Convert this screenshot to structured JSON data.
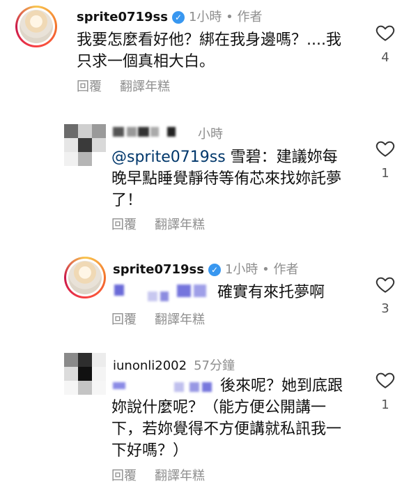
{
  "comments": [
    {
      "username": "sprite0719ss",
      "time": "1小時",
      "badge": "作者",
      "text": "我要怎麼看好他？綁在我身邊嗎？....我只求一個真相大白。",
      "reply": "回覆",
      "translate": "翻譯年糕",
      "likes": "4"
    },
    {
      "time": "小時",
      "mention": "@sprite0719ss",
      "text": " 雪碧：建議妳每晚早點睡覺靜待等侑芯來找妳託夢了！",
      "reply": "回覆",
      "translate": "翻譯年糕",
      "likes": "1"
    },
    {
      "username": "sprite0719ss",
      "time": "1小時",
      "badge": "作者",
      "text": "確實有來托夢啊",
      "reply": "回覆",
      "translate": "翻譯年糕",
      "likes": "3"
    },
    {
      "username": "iunonli2002",
      "time": "57分鐘",
      "text": "後來呢？她到底跟妳說什麼呢？（能方便公開講一下，若妳覺得不方便講就私訊我一下好嗎？）",
      "reply": "回覆",
      "translate": "翻譯年糕",
      "likes": "1"
    }
  ],
  "icons": {
    "like": "heart-outline-icon",
    "verified": "verified-badge-icon"
  },
  "colors": {
    "verified": "#3897f0",
    "secondary_text": "#8e8e8e",
    "mention": "#00376b"
  }
}
